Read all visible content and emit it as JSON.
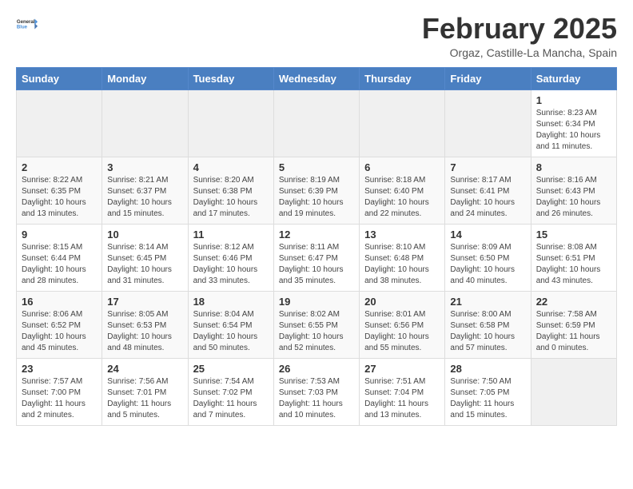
{
  "header": {
    "logo_line1": "General",
    "logo_line2": "Blue",
    "title": "February 2025",
    "subtitle": "Orgaz, Castille-La Mancha, Spain"
  },
  "weekdays": [
    "Sunday",
    "Monday",
    "Tuesday",
    "Wednesday",
    "Thursday",
    "Friday",
    "Saturday"
  ],
  "weeks": [
    [
      {
        "day": "",
        "info": ""
      },
      {
        "day": "",
        "info": ""
      },
      {
        "day": "",
        "info": ""
      },
      {
        "day": "",
        "info": ""
      },
      {
        "day": "",
        "info": ""
      },
      {
        "day": "",
        "info": ""
      },
      {
        "day": "1",
        "info": "Sunrise: 8:23 AM\nSunset: 6:34 PM\nDaylight: 10 hours and 11 minutes."
      }
    ],
    [
      {
        "day": "2",
        "info": "Sunrise: 8:22 AM\nSunset: 6:35 PM\nDaylight: 10 hours and 13 minutes."
      },
      {
        "day": "3",
        "info": "Sunrise: 8:21 AM\nSunset: 6:37 PM\nDaylight: 10 hours and 15 minutes."
      },
      {
        "day": "4",
        "info": "Sunrise: 8:20 AM\nSunset: 6:38 PM\nDaylight: 10 hours and 17 minutes."
      },
      {
        "day": "5",
        "info": "Sunrise: 8:19 AM\nSunset: 6:39 PM\nDaylight: 10 hours and 19 minutes."
      },
      {
        "day": "6",
        "info": "Sunrise: 8:18 AM\nSunset: 6:40 PM\nDaylight: 10 hours and 22 minutes."
      },
      {
        "day": "7",
        "info": "Sunrise: 8:17 AM\nSunset: 6:41 PM\nDaylight: 10 hours and 24 minutes."
      },
      {
        "day": "8",
        "info": "Sunrise: 8:16 AM\nSunset: 6:43 PM\nDaylight: 10 hours and 26 minutes."
      }
    ],
    [
      {
        "day": "9",
        "info": "Sunrise: 8:15 AM\nSunset: 6:44 PM\nDaylight: 10 hours and 28 minutes."
      },
      {
        "day": "10",
        "info": "Sunrise: 8:14 AM\nSunset: 6:45 PM\nDaylight: 10 hours and 31 minutes."
      },
      {
        "day": "11",
        "info": "Sunrise: 8:12 AM\nSunset: 6:46 PM\nDaylight: 10 hours and 33 minutes."
      },
      {
        "day": "12",
        "info": "Sunrise: 8:11 AM\nSunset: 6:47 PM\nDaylight: 10 hours and 35 minutes."
      },
      {
        "day": "13",
        "info": "Sunrise: 8:10 AM\nSunset: 6:48 PM\nDaylight: 10 hours and 38 minutes."
      },
      {
        "day": "14",
        "info": "Sunrise: 8:09 AM\nSunset: 6:50 PM\nDaylight: 10 hours and 40 minutes."
      },
      {
        "day": "15",
        "info": "Sunrise: 8:08 AM\nSunset: 6:51 PM\nDaylight: 10 hours and 43 minutes."
      }
    ],
    [
      {
        "day": "16",
        "info": "Sunrise: 8:06 AM\nSunset: 6:52 PM\nDaylight: 10 hours and 45 minutes."
      },
      {
        "day": "17",
        "info": "Sunrise: 8:05 AM\nSunset: 6:53 PM\nDaylight: 10 hours and 48 minutes."
      },
      {
        "day": "18",
        "info": "Sunrise: 8:04 AM\nSunset: 6:54 PM\nDaylight: 10 hours and 50 minutes."
      },
      {
        "day": "19",
        "info": "Sunrise: 8:02 AM\nSunset: 6:55 PM\nDaylight: 10 hours and 52 minutes."
      },
      {
        "day": "20",
        "info": "Sunrise: 8:01 AM\nSunset: 6:56 PM\nDaylight: 10 hours and 55 minutes."
      },
      {
        "day": "21",
        "info": "Sunrise: 8:00 AM\nSunset: 6:58 PM\nDaylight: 10 hours and 57 minutes."
      },
      {
        "day": "22",
        "info": "Sunrise: 7:58 AM\nSunset: 6:59 PM\nDaylight: 11 hours and 0 minutes."
      }
    ],
    [
      {
        "day": "23",
        "info": "Sunrise: 7:57 AM\nSunset: 7:00 PM\nDaylight: 11 hours and 2 minutes."
      },
      {
        "day": "24",
        "info": "Sunrise: 7:56 AM\nSunset: 7:01 PM\nDaylight: 11 hours and 5 minutes."
      },
      {
        "day": "25",
        "info": "Sunrise: 7:54 AM\nSunset: 7:02 PM\nDaylight: 11 hours and 7 minutes."
      },
      {
        "day": "26",
        "info": "Sunrise: 7:53 AM\nSunset: 7:03 PM\nDaylight: 11 hours and 10 minutes."
      },
      {
        "day": "27",
        "info": "Sunrise: 7:51 AM\nSunset: 7:04 PM\nDaylight: 11 hours and 13 minutes."
      },
      {
        "day": "28",
        "info": "Sunrise: 7:50 AM\nSunset: 7:05 PM\nDaylight: 11 hours and 15 minutes."
      },
      {
        "day": "",
        "info": ""
      }
    ]
  ]
}
